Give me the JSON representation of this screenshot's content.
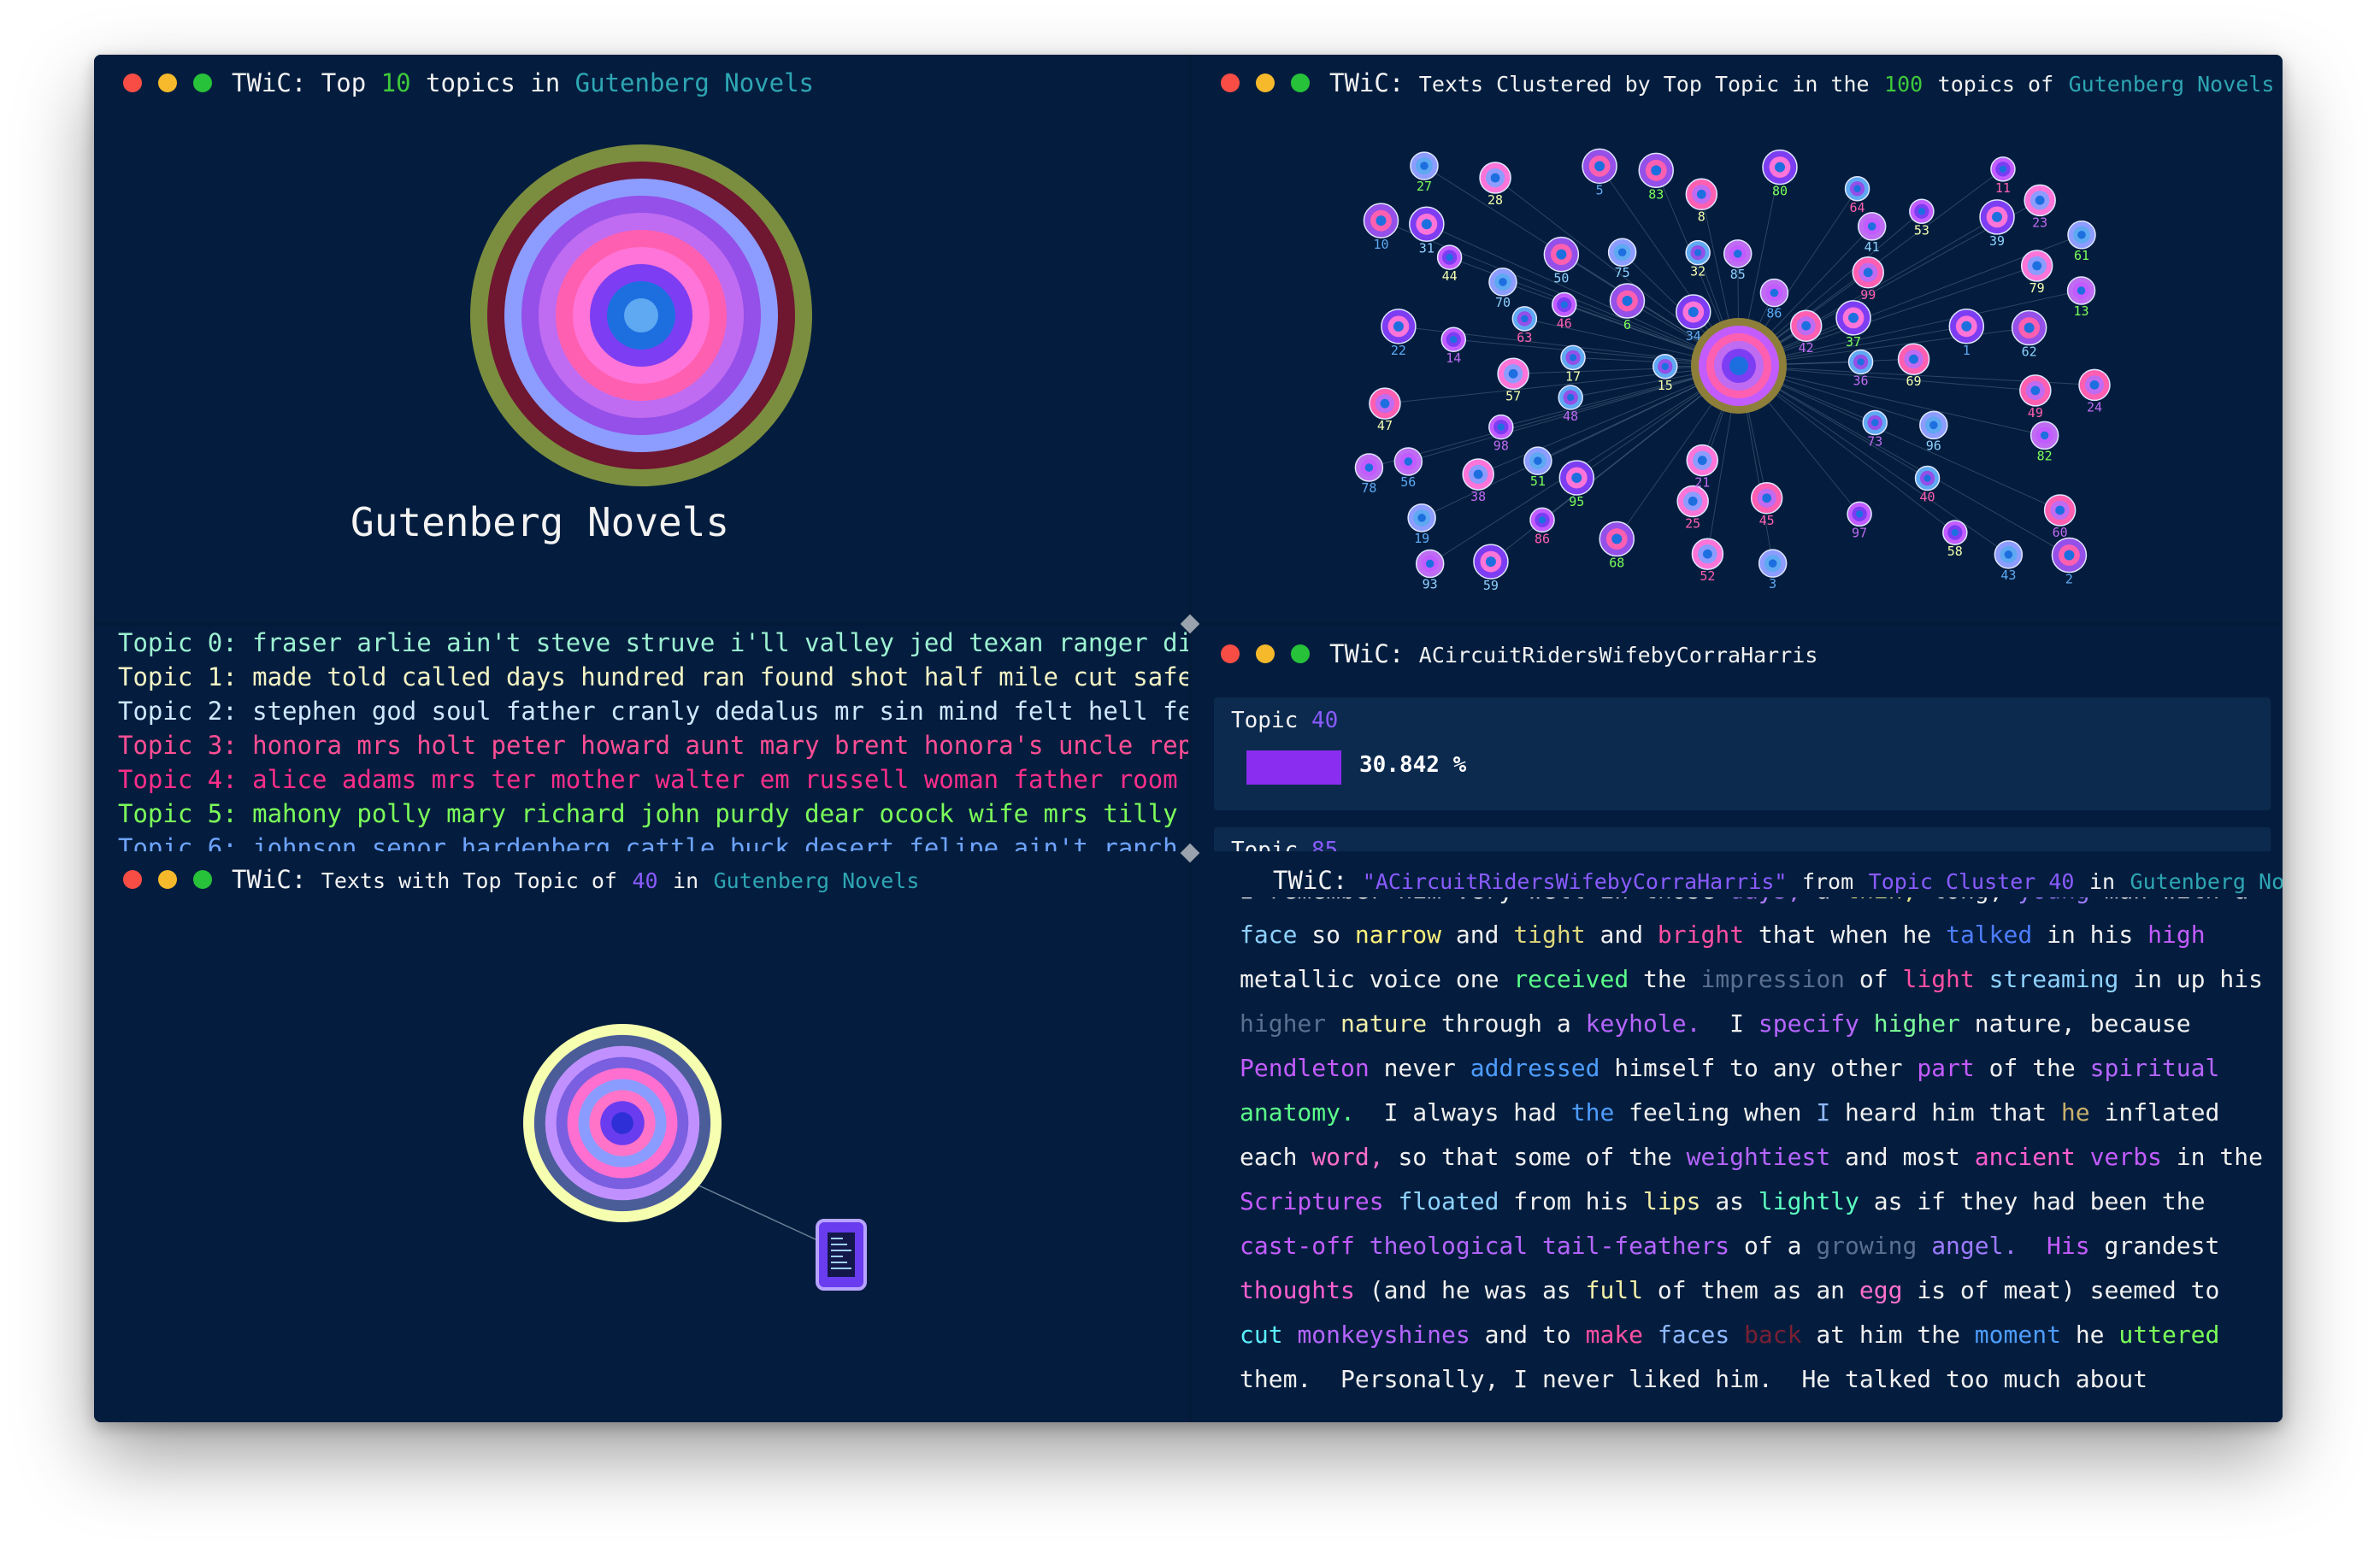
{
  "panels": {
    "top_topics": {
      "title_prefix": "TWiC:",
      "title_a": "Top",
      "title_num": "10",
      "title_b": "topics in",
      "title_corpus": "Gutenberg Novels",
      "corpus_label": "Gutenberg Novels",
      "ring_colors": [
        "#7b8d3f",
        "#6f1630",
        "#8d9cff",
        "#9450e8",
        "#bf6bf2",
        "#ff5fb0",
        "#ff74d8",
        "#7d3df3",
        "#1d6fe0",
        "#5ea9f2"
      ]
    },
    "cluster": {
      "title_prefix": "TWiC:",
      "title_a": "Texts Clustered by Top Topic in the",
      "title_num": "100",
      "title_b": "topics of",
      "title_corpus": "Gutenberg Novels",
      "node_labels": [
        "44",
        "19",
        "42",
        "95",
        "64",
        "85",
        "28",
        "2",
        "14",
        "61",
        "99",
        "59",
        "32",
        "86",
        "38",
        "6",
        "86",
        "96",
        "8",
        "22",
        "73",
        "13",
        "25",
        "50",
        "53",
        "43",
        "60",
        "80",
        "63",
        "93",
        "79",
        "10",
        "97",
        "27",
        "45",
        "39",
        "17",
        "78",
        "21",
        "68",
        "46",
        "70",
        "47",
        "34",
        "36",
        "82",
        "52",
        "62",
        "58",
        "3",
        "24",
        "37",
        "40",
        "41",
        "57",
        "5",
        "98",
        "51",
        "49",
        "31",
        "15",
        "56",
        "23",
        "83",
        "11",
        "75",
        "69",
        "1",
        "48"
      ]
    },
    "topic_list": {
      "rows": [
        {
          "label": "Topic 0:",
          "words": "fraser arlie ain't steve struve i'll valley jed texan ranger dick abcb re",
          "color": "#9df2d2"
        },
        {
          "label": "Topic 1:",
          "words": "made told called days hundred ran found shot half mile cut safe caught co",
          "color": "#f4f4c4"
        },
        {
          "label": "Topic 2:",
          "words": "stephen god soul father cranly dedalus mr sin mind felt hell fellows life",
          "color": "#cfe7ff"
        },
        {
          "label": "Topic 3:",
          "words": "honora mrs holt peter howard aunt mary brent honora's uncle replied tom s",
          "color": "#ff4e95"
        },
        {
          "label": "Topic 4:",
          "words": "alice adams mrs ter mother walter em russell woman father room papa kind",
          "color": "#ff2e8a"
        },
        {
          "label": "Topic 5:",
          "words": "mahony polly mary richard john purdy dear ocock wife mrs tilly husband ji",
          "color": "#7cff5a"
        },
        {
          "label": "Topic 6:",
          "words": "johnson senor hardenberg cattle buck desert felipe ain't ranch jed rode b",
          "color": "#6ea4ff"
        }
      ]
    },
    "text_info": {
      "title_prefix": "TWiC:",
      "title_text": "ACircuitRidersWifebyCorraHarris",
      "topic_label": "Topic",
      "topic_num": "40",
      "percent": "30.842 %",
      "percent_value": 30.842,
      "topic2_label": "Topic",
      "topic2_num": "85"
    },
    "texts_topic": {
      "title_prefix": "TWiC:",
      "title_a": "Texts with Top Topic of",
      "title_num": "40",
      "title_b": "in",
      "title_corpus": "Gutenberg Novels"
    },
    "reader": {
      "title_prefix": "TWiC:",
      "title_text": "\"ACircuitRidersWifebyCorraHarris\"",
      "title_from": "from",
      "title_cluster": "Topic Cluster 40",
      "title_in": "in",
      "title_corpus": "Gutenberg Novels",
      "lines": [
        [
          [
            "I remember him very well in those ",
            "#f1f1f1"
          ],
          [
            "days, ",
            "#b07cff"
          ],
          [
            "a ",
            "#f1f1f1"
          ],
          [
            "thin, ",
            "#e7e78a"
          ],
          [
            "long, ",
            "#f1f1f1"
          ],
          [
            "young ",
            "#9d7bff"
          ],
          [
            "man with a",
            "#f1f1f1"
          ]
        ],
        [
          [
            "face ",
            "#8fd2ff"
          ],
          [
            "so ",
            "#f1f1f1"
          ],
          [
            "narrow ",
            "#fff27a"
          ],
          [
            "and ",
            "#f1f1f1"
          ],
          [
            "tight ",
            "#e0d77c"
          ],
          [
            "and ",
            "#f1f1f1"
          ],
          [
            "bright ",
            "#ff4fa3"
          ],
          [
            "that when he ",
            "#f1f1f1"
          ],
          [
            "talked ",
            "#4e7dff"
          ],
          [
            "in his ",
            "#f1f1f1"
          ],
          [
            "high",
            "#c35cff"
          ]
        ],
        [
          [
            "metallic voice ",
            "#f1f1f1"
          ],
          [
            "one ",
            "#f1f1f1"
          ],
          [
            "received ",
            "#5cff8a"
          ],
          [
            "the ",
            "#f1f1f1"
          ],
          [
            "impression ",
            "#5b6f90"
          ],
          [
            "of ",
            "#f1f1f1"
          ],
          [
            "light ",
            "#ff4fa3"
          ],
          [
            "streaming ",
            "#8fd2ff"
          ],
          [
            "in up his",
            "#f1f1f1"
          ]
        ],
        [
          [
            "higher ",
            "#5b6f90"
          ],
          [
            "nature ",
            "#f4f0a8"
          ],
          [
            "through a ",
            "#f1f1f1"
          ],
          [
            "keyhole.",
            "#b565ff"
          ],
          [
            "  I ",
            "#f1f1f1"
          ],
          [
            "specify ",
            "#b565ff"
          ],
          [
            "higher ",
            "#7cff9a"
          ],
          [
            "nature, because",
            "#f1f1f1"
          ]
        ],
        [
          [
            "Pendleton ",
            "#c35cff"
          ],
          [
            "never ",
            "#f1f1f1"
          ],
          [
            "addressed ",
            "#4e9dff"
          ],
          [
            "himself to any other ",
            "#f1f1f1"
          ],
          [
            "part ",
            "#c35cff"
          ],
          [
            "of the ",
            "#f1f1f1"
          ],
          [
            "spiritual",
            "#b565ff"
          ]
        ],
        [
          [
            "anatomy.",
            "#5cff8a"
          ],
          [
            "  I always had ",
            "#f1f1f1"
          ],
          [
            "the ",
            "#4e9dff"
          ],
          [
            "feeling when ",
            "#f1f1f1"
          ],
          [
            "I ",
            "#8fb8ff"
          ],
          [
            "heard him that ",
            "#f1f1f1"
          ],
          [
            "he ",
            "#c9b06b"
          ],
          [
            "inflated",
            "#f1f1f1"
          ]
        ],
        [
          [
            "each ",
            "#f1f1f1"
          ],
          [
            "word, ",
            "#ff6fcc"
          ],
          [
            "so that some of the ",
            "#f1f1f1"
          ],
          [
            "weightiest ",
            "#b565ff"
          ],
          [
            "and most ",
            "#f1f1f1"
          ],
          [
            "ancient ",
            "#ff5fd0"
          ],
          [
            "verbs ",
            "#c35cff"
          ],
          [
            "in the",
            "#f1f1f1"
          ]
        ],
        [
          [
            "Scriptures ",
            "#c35cff"
          ],
          [
            "floated ",
            "#8fd2ff"
          ],
          [
            "from his ",
            "#f1f1f1"
          ],
          [
            "lips ",
            "#f4f0a8"
          ],
          [
            "as ",
            "#f1f1f1"
          ],
          [
            "lightly ",
            "#5cffc0"
          ],
          [
            "as if they had been the",
            "#f1f1f1"
          ]
        ],
        [
          [
            "cast-off ",
            "#c35cff"
          ],
          [
            "theological ",
            "#b565ff"
          ],
          [
            "tail-feathers ",
            "#b565ff"
          ],
          [
            "of a ",
            "#f1f1f1"
          ],
          [
            "growing ",
            "#5b6f90"
          ],
          [
            "angel.",
            "#9d7bff"
          ],
          [
            "  His ",
            "#c35cff"
          ],
          [
            "grandest",
            "#f1f1f1"
          ]
        ],
        [
          [
            "thoughts ",
            "#ff5fd0"
          ],
          [
            "(and he was as ",
            "#f1f1f1"
          ],
          [
            "full ",
            "#f4f0a8"
          ],
          [
            "of them as an ",
            "#f1f1f1"
          ],
          [
            "egg ",
            "#ff6fcc"
          ],
          [
            "is of meat) seemed to",
            "#f1f1f1"
          ]
        ],
        [
          [
            "cut ",
            "#5cf0ff"
          ],
          [
            "monkeyshines ",
            "#b565ff"
          ],
          [
            "and to ",
            "#f1f1f1"
          ],
          [
            "make ",
            "#ff4fa3"
          ],
          [
            "faces ",
            "#8fb8ff"
          ],
          [
            "back ",
            "#7a1f33"
          ],
          [
            "at him the ",
            "#f1f1f1"
          ],
          [
            "moment ",
            "#4e9dff"
          ],
          [
            "he ",
            "#f1f1f1"
          ],
          [
            "uttered",
            "#7cff5a"
          ]
        ],
        [
          [
            "them.  Personally, I never liked him.  He talked too much about",
            "#f1f1f1"
          ]
        ]
      ]
    },
    "small_rings": [
      "#f6ffb0",
      "#4b5d99",
      "#c090ff",
      "#7a5fe0",
      "#ff6fd0",
      "#8a9cff",
      "#ff74c8",
      "#6a3cf0",
      "#2f2fd8"
    ]
  }
}
